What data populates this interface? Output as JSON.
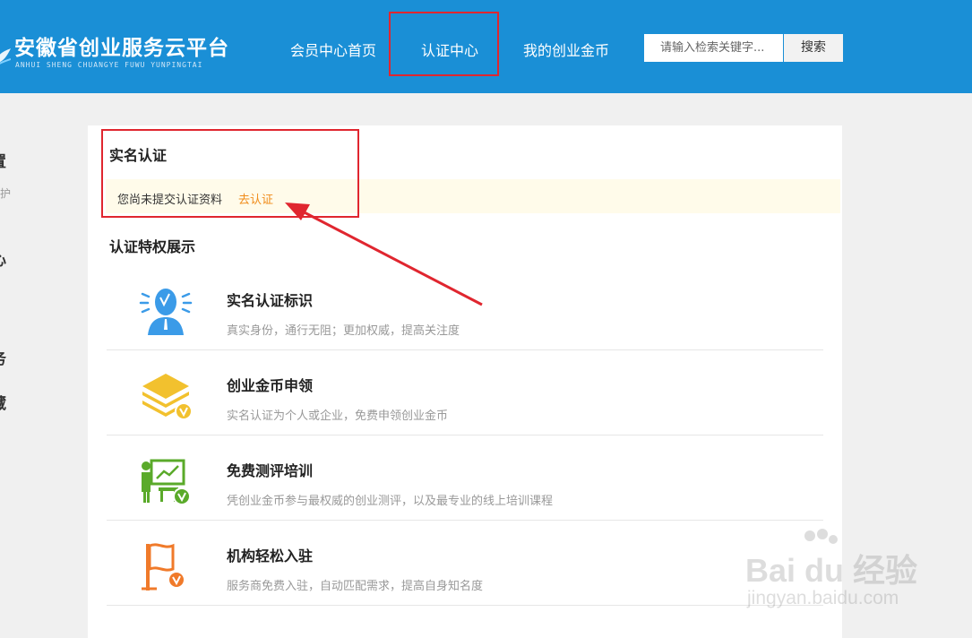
{
  "header": {
    "logo_title": "安徽省创业服务云平台",
    "logo_subtitle": "ANHUI SHENG CHUANGYE FUWU YUNPINGTAI",
    "nav": [
      "会员中心首页",
      "认证中心",
      "我的创业金币"
    ],
    "search": {
      "placeholder": "请输入检索关键字...",
      "button": "搜索"
    }
  },
  "sidebar_fragments": [
    "置",
    "维护",
    "心",
    "务",
    "藏"
  ],
  "real_name": {
    "title": "实名认证",
    "notice": "您尚未提交认证资料",
    "action": "去认证"
  },
  "privileges": {
    "title": "认证特权展示",
    "items": [
      {
        "title": "实名认证标识",
        "desc": "真实身份，通行无阻；更加权威，提高关注度",
        "icon": "verified-user-icon"
      },
      {
        "title": "创业金币申领",
        "desc": "实名认证为个人或企业，免费申领创业金币",
        "icon": "coin-stack-icon"
      },
      {
        "title": "免费测评培训",
        "desc": "凭创业金币参与最权威的创业测评，以及最专业的线上培训课程",
        "icon": "training-board-icon"
      },
      {
        "title": "机构轻松入驻",
        "desc": "服务商免费入驻，自动匹配需求，提高自身知名度",
        "icon": "flag-icon"
      }
    ]
  },
  "watermark": {
    "main": "Bai du 经验",
    "sub": "jingyan.baidu.com"
  },
  "colors": {
    "header_bg": "#1a8fd6",
    "highlight": "#e0262f",
    "link": "#f08c1a",
    "notice_bg": "#fffbea"
  }
}
